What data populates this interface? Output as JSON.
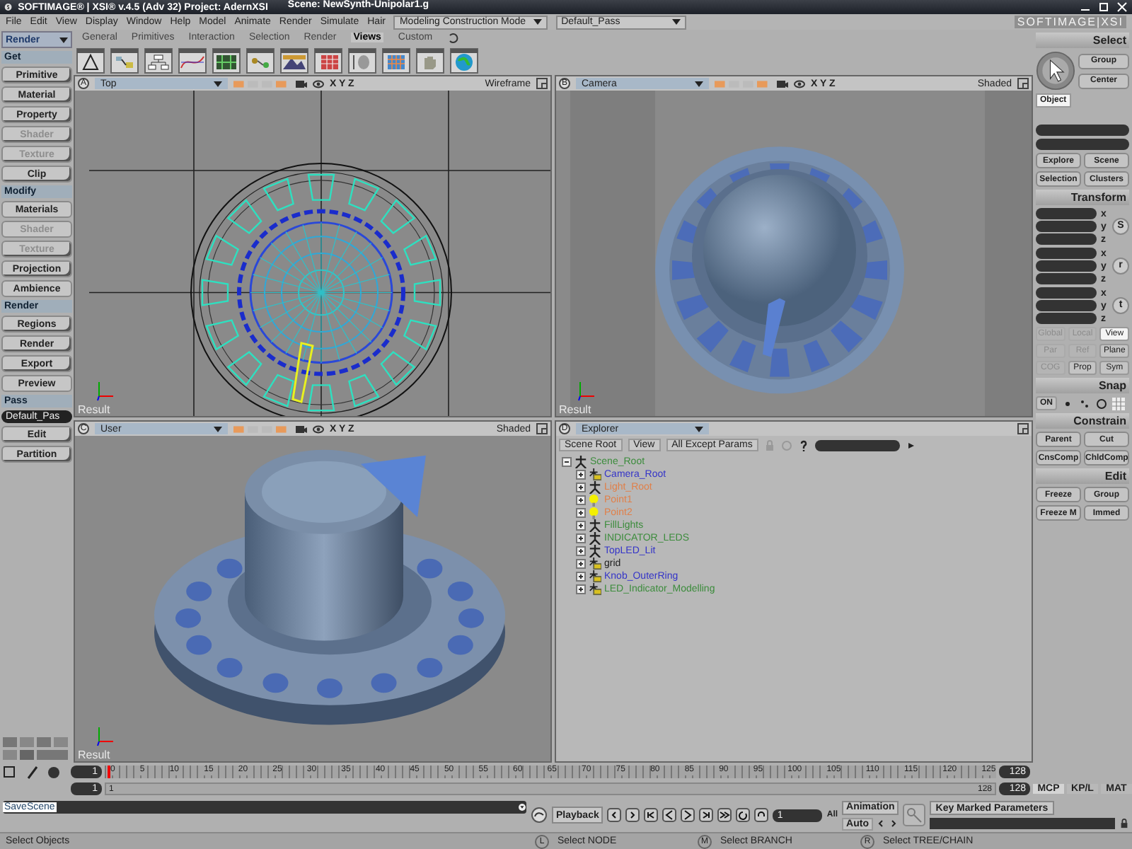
{
  "window": {
    "title": "SOFTIMAGE® | XSI® v.4.5 (Adv 32) Project: AdernXSI",
    "scene": "Scene: NewSynth-Unipolar1.g"
  },
  "menu": [
    "File",
    "Edit",
    "View",
    "Display",
    "Window",
    "Help",
    "Model",
    "Animate",
    "Render",
    "Simulate",
    "Hair"
  ],
  "mode_dropdown": "Modeling Construction Mode",
  "pass_dropdown": "Default_Pass",
  "brand": "SOFTIMAGE|XSI",
  "toolbar_tabs": [
    {
      "label": "General",
      "selected": false
    },
    {
      "label": "Primitives",
      "selected": false
    },
    {
      "label": "Interaction",
      "selected": false
    },
    {
      "label": "Selection",
      "selected": false
    },
    {
      "label": "Render",
      "selected": false
    },
    {
      "label": "Views",
      "selected": true
    },
    {
      "label": "Custom",
      "selected": false
    }
  ],
  "left_panel": {
    "module": "Render",
    "sections": [
      {
        "title": "Get",
        "items": [
          {
            "label": "Primitive",
            "disabled": false,
            "submenu": true
          },
          {
            "label": "Material",
            "disabled": false,
            "submenu": true
          },
          {
            "label": "Property",
            "disabled": false,
            "submenu": true
          },
          {
            "label": "Shader",
            "disabled": true,
            "submenu": true
          },
          {
            "label": "Texture",
            "disabled": true,
            "submenu": true
          },
          {
            "label": "Clip",
            "disabled": false,
            "submenu": true
          }
        ]
      },
      {
        "title": "Modify",
        "items": [
          {
            "label": "Materials",
            "disabled": false,
            "submenu": false
          },
          {
            "label": "Shader",
            "disabled": true,
            "submenu": false
          },
          {
            "label": "Texture",
            "disabled": true,
            "submenu": true
          },
          {
            "label": "Projection",
            "disabled": false,
            "submenu": true
          },
          {
            "label": "Ambience",
            "disabled": false,
            "submenu": false
          }
        ]
      },
      {
        "title": "Render",
        "items": [
          {
            "label": "Regions",
            "disabled": false,
            "submenu": true
          },
          {
            "label": "Render",
            "disabled": false,
            "submenu": true
          },
          {
            "label": "Export",
            "disabled": false,
            "submenu": true
          },
          {
            "label": "Preview",
            "disabled": false,
            "submenu": false
          }
        ]
      },
      {
        "title": "Pass",
        "dropdown": "Default_Pas",
        "items": [
          {
            "label": "Edit",
            "disabled": false,
            "submenu": true
          },
          {
            "label": "Partition",
            "disabled": false,
            "submenu": true
          }
        ]
      }
    ]
  },
  "viewports": [
    {
      "letter": "A",
      "camera": "Top",
      "axes": "X Y Z",
      "mode": "Wireframe",
      "kind": "wireframe",
      "footer": "Result"
    },
    {
      "letter": "B",
      "camera": "Camera",
      "axes": "X Y Z",
      "mode": "Shaded",
      "kind": "camera",
      "footer": "Result"
    },
    {
      "letter": "C",
      "camera": "User",
      "axes": "X Y Z",
      "mode": "Shaded",
      "kind": "perspective",
      "footer": "Result"
    },
    {
      "letter": "D",
      "camera": "Explorer",
      "kind": "explorer"
    }
  ],
  "explorer": {
    "buttons": [
      "Scene Root",
      "View",
      "All Except Params"
    ],
    "tree": [
      {
        "label": "Scene_Root",
        "kind": "null",
        "color": "#3c8c3c",
        "expanded": true,
        "children": [
          {
            "label": "Camera_Root",
            "kind": "model",
            "color": "#3434c8",
            "expanded": false
          },
          {
            "label": "Light_Root",
            "kind": "null",
            "color": "#e0804a",
            "expanded": false
          },
          {
            "label": "Point1",
            "kind": "light",
            "color": "#e0804a",
            "expanded": false
          },
          {
            "label": "Point2",
            "kind": "light",
            "color": "#e0804a",
            "expanded": false
          },
          {
            "label": "FillLights",
            "kind": "null",
            "color": "#3c8c3c",
            "expanded": false
          },
          {
            "label": "INDICATOR_LEDS",
            "kind": "null",
            "color": "#3c8c3c",
            "expanded": false
          },
          {
            "label": "TopLED_Lit",
            "kind": "null",
            "color": "#3434c8",
            "expanded": false
          },
          {
            "label": "grid",
            "kind": "model",
            "color": "#202020",
            "expanded": false
          },
          {
            "label": "Knob_OuterRing",
            "kind": "model",
            "color": "#3434c8",
            "expanded": false
          },
          {
            "label": "LED_Indicator_Modelling",
            "kind": "model",
            "color": "#3c8c3c",
            "expanded": false
          }
        ]
      }
    ]
  },
  "select_panel": {
    "title": "Select",
    "buttons": [
      "Group",
      "Center"
    ],
    "filter": {
      "label": "Object",
      "selected": true
    },
    "lower_buttons": [
      "Explore",
      "Scene",
      "Selection",
      "Clusters"
    ]
  },
  "transform_panel": {
    "title": "Transform",
    "groups": [
      {
        "label": "S",
        "axes": [
          "x",
          "y",
          "z"
        ]
      },
      {
        "label": "r",
        "axes": [
          "x",
          "y",
          "z"
        ]
      },
      {
        "label": "t",
        "axes": [
          "x",
          "y",
          "z"
        ]
      }
    ],
    "spaces": [
      {
        "label": "Global",
        "selected": false,
        "disabled": true
      },
      {
        "label": "Local",
        "selected": false,
        "disabled": true
      },
      {
        "label": "View",
        "selected": true,
        "disabled": false
      },
      {
        "label": "Par",
        "selected": false,
        "disabled": true
      },
      {
        "label": "Ref",
        "selected": false,
        "disabled": true
      },
      {
        "label": "Plane",
        "selected": false,
        "disabled": false
      },
      {
        "label": "COG",
        "selected": false,
        "disabled": true
      },
      {
        "label": "Prop",
        "selected": false,
        "disabled": false
      },
      {
        "label": "Sym",
        "selected": false,
        "disabled": false
      }
    ]
  },
  "snap_panel": {
    "title": "Snap",
    "toggle": "ON"
  },
  "constrain_panel": {
    "title": "Constrain",
    "buttons": [
      "Parent",
      "Cut",
      "CnsComp",
      "ChldComp"
    ]
  },
  "edit_panel": {
    "title": "Edit",
    "buttons": [
      "Freeze",
      "Group",
      "Freeze M",
      "Immed"
    ]
  },
  "timeline": {
    "start_field": "1",
    "end_field": "128",
    "range_start_field": "1",
    "range_end_field": "128",
    "range_start_label": "1",
    "range_end_label": "128",
    "ticks": [
      "0",
      "5",
      "10",
      "15",
      "20",
      "25",
      "30",
      "35",
      "40",
      "45",
      "50",
      "55",
      "60",
      "65",
      "70",
      "75",
      "80",
      "85",
      "90",
      "95",
      "100",
      "105",
      "110",
      "115",
      "120",
      "125"
    ]
  },
  "mcp_tabs": [
    {
      "label": "MCP",
      "selected": true
    },
    {
      "label": "KP/L",
      "selected": false
    },
    {
      "label": "MAT",
      "selected": false
    }
  ],
  "command_line": {
    "value": "SaveScene"
  },
  "playback": {
    "button": "Playback",
    "frame": "1",
    "range": "All"
  },
  "animation": {
    "button": "Animation",
    "auto": "Auto",
    "key_button": "Key Marked Parameters"
  },
  "status_bar": {
    "message": "Select Objects",
    "mouse_hints": [
      {
        "key": "L",
        "label": "Select NODE"
      },
      {
        "key": "M",
        "label": "Select BRANCH"
      },
      {
        "key": "R",
        "label": "Select TREE/CHAIN"
      }
    ]
  }
}
